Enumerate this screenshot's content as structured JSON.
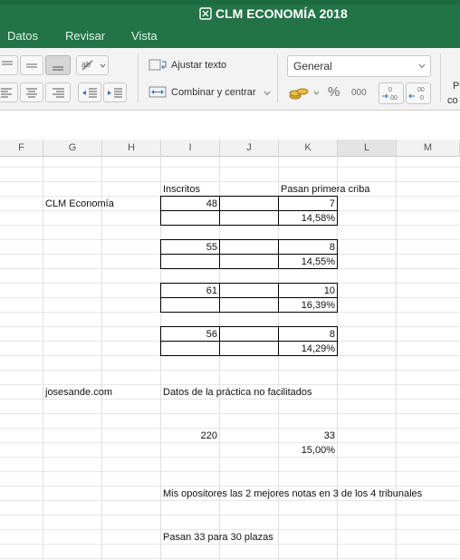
{
  "window": {
    "title": "CLM ECONOMÍA 2018"
  },
  "menu": {
    "items": [
      "Datos",
      "Revisar",
      "Vista"
    ]
  },
  "ribbon": {
    "wrap_text_label": "Ajustar texto",
    "merge_center_label": "Combinar y centrar",
    "number_format": "General",
    "percent_symbol": "%",
    "thousands_symbol": "000",
    "cut_off_label_1": "P",
    "cut_off_label_2": "co"
  },
  "columns": [
    "F",
    "G",
    "H",
    "I",
    "J",
    "K",
    "L",
    "M"
  ],
  "selected_column": "L",
  "cells": {
    "i_header": "Inscritos",
    "k_header": "Pasan primera criba",
    "g_label": "CLM Economía",
    "group1": {
      "inscritos": "48",
      "pasan": "7",
      "pct": "14,58%"
    },
    "group2": {
      "inscritos": "55",
      "pasan": "8",
      "pct": "14,55%"
    },
    "group3": {
      "inscritos": "61",
      "pasan": "10",
      "pct": "16,39%"
    },
    "group4": {
      "inscritos": "56",
      "pasan": "8",
      "pct": "14,29%"
    },
    "g_site": "josesande.com",
    "note_missing": "Datos de la práctica no facilitados",
    "total_inscritos": "220",
    "total_pasan": "33",
    "total_pct": "15,00%",
    "note_opponents": "Mis opositores las 2 mejores notas en 3 de los 4 tribunales",
    "note_places": "Pasan 33 para 30 plazas"
  },
  "colors": {
    "titlebar": "#227447",
    "ribbon": "#f3f3f3",
    "grid_line": "#e0e0e0"
  }
}
